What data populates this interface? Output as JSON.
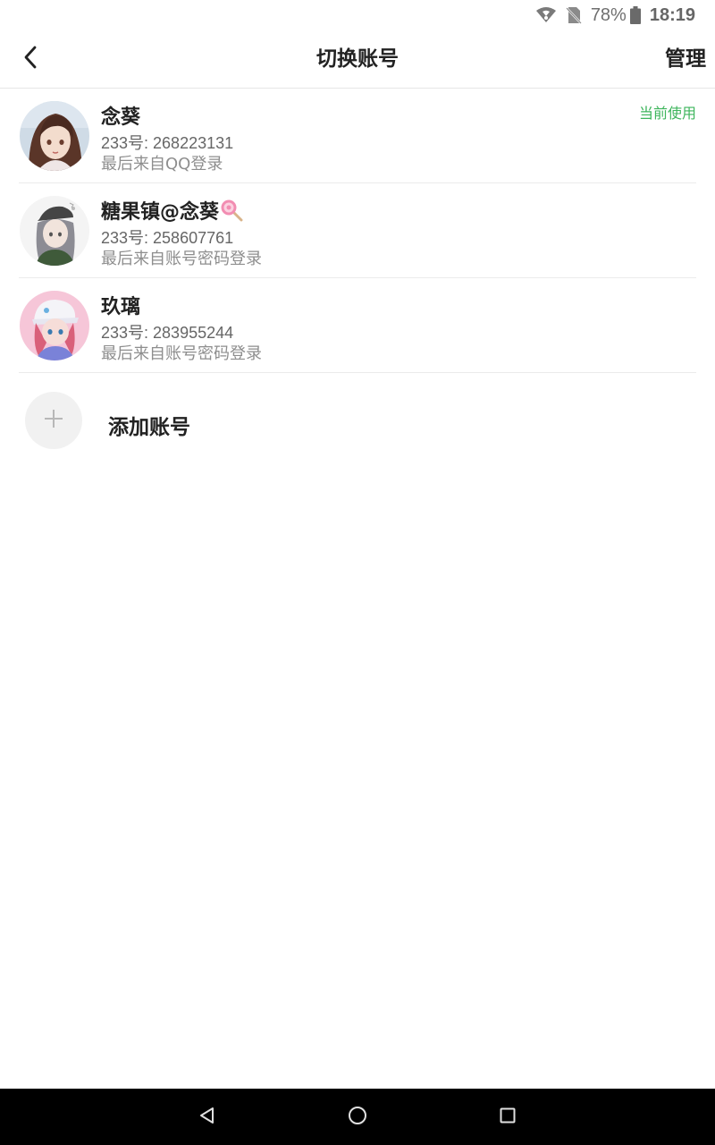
{
  "status_bar": {
    "battery_percent": "78%",
    "time": "18:19",
    "icons": [
      "wifi-icon",
      "no-sim-icon",
      "battery-icon"
    ]
  },
  "header": {
    "title": "切换账号",
    "manage_label": "管理",
    "back_icon": "back-arrow-icon"
  },
  "accounts": [
    {
      "name": "念葵",
      "id_text": "233号: 268223131",
      "login_text": "最后来自QQ登录",
      "badge": "当前使用"
    },
    {
      "name": "糖果镇@念葵",
      "name_emoji": "lollipop-icon",
      "id_text": "233号: 258607761",
      "login_text": "最后来自账号密码登录"
    },
    {
      "name": "玖璃",
      "id_text": "233号: 283955244",
      "login_text": "最后来自账号密码登录"
    }
  ],
  "add_account": {
    "label": "添加账号",
    "icon": "plus-icon"
  },
  "colors": {
    "accent_green": "#3eb55c",
    "text_primary": "#222222",
    "text_secondary": "#8e8e8e",
    "navbar_bg": "#000000"
  }
}
